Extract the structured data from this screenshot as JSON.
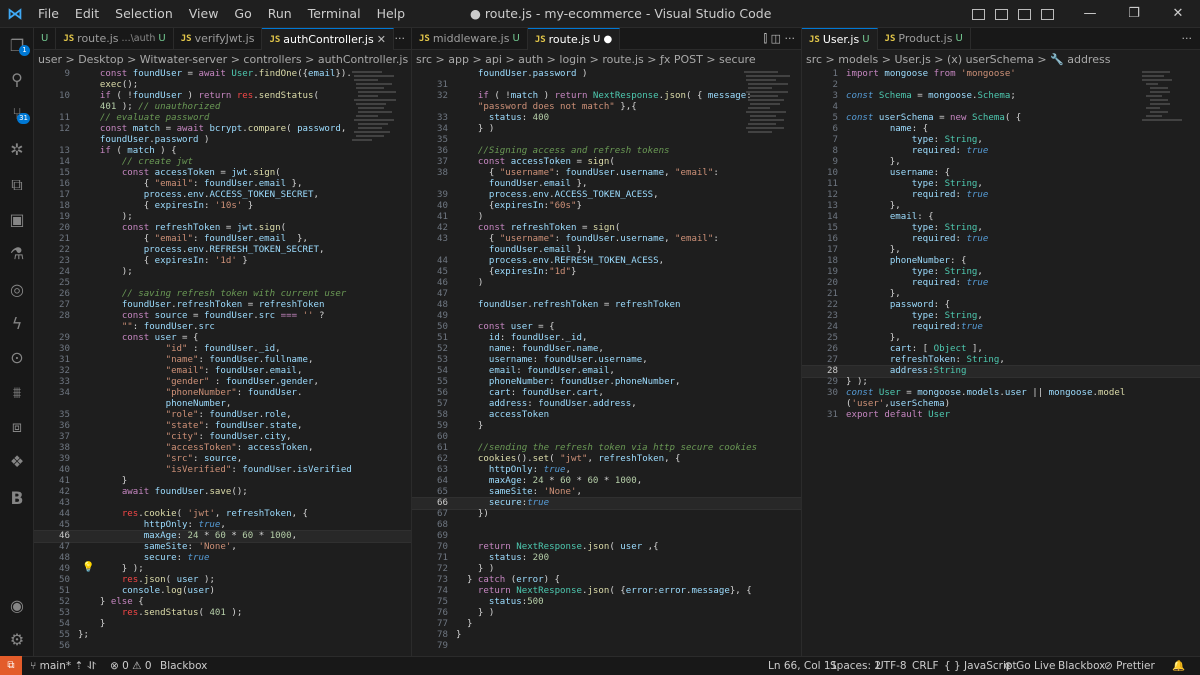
{
  "titlebar": {
    "menus": [
      "File",
      "Edit",
      "Selection",
      "View",
      "Go",
      "Run",
      "Terminal",
      "Help"
    ],
    "title": "● route.js - my-ecommerce - Visual Studio Code",
    "buttons": {
      "minimize": "—",
      "restore": "❐",
      "close": "✕"
    }
  },
  "activity": {
    "source_control_badge": "31",
    "explorer_badge": "1",
    "blackbox_letter": "B"
  },
  "groups": [
    {
      "tabs": [
        {
          "label": "U",
          "extra": "",
          "status": "",
          "active": false
        },
        {
          "label": "route.js",
          "extra": "...\\auth",
          "status": "U",
          "active": false
        },
        {
          "label": "verifyJwt.js",
          "extra": "",
          "status": "",
          "active": false
        },
        {
          "label": "authController.js",
          "extra": "",
          "status": "✕",
          "active": true
        }
      ],
      "more": "···",
      "breadcrumb": "user > Desktop > Witwater-server > controllers > authController.js > (x) handleLogin >"
    },
    {
      "tabs": [
        {
          "label": "middleware.js",
          "extra": "",
          "status": "U",
          "active": false
        },
        {
          "label": "route.js",
          "extra": "",
          "status": "U ●",
          "active": true
        }
      ],
      "more": "⫿  ◫  ···",
      "breadcrumb": "src > app > api > auth > login > route.js > ƒx POST > secure"
    },
    {
      "tabs": [
        {
          "label": "User.js",
          "extra": "",
          "status": "U",
          "active": false
        },
        {
          "label": "Product.js",
          "extra": "",
          "status": "U",
          "active": false
        }
      ],
      "more": "···",
      "breadcrumb": "src > models > User.js > (x) userSchema > 🔧 address"
    }
  ],
  "code1": [
    {
      "n": "9",
      "h": "    <span class=\"k\">const</span> <span class=\"v\">foundUser</span> = <span class=\"k\">await</span> <span class=\"t\">User</span>.<span class=\"f\">findOne</span>({<span class=\"v\">email</span>})."
    },
    {
      "n": "",
      "h": "    <span class=\"f\">exec</span>();"
    },
    {
      "n": "10",
      "h": "    <span class=\"k\">if</span> ( !<span class=\"v\">foundUser</span> ) <span class=\"k\">return</span> <span class=\"r\">res</span>.<span class=\"f\">sendStatus</span>("
    },
    {
      "n": "",
      "h": "    <span class=\"n\">401</span> ); <span class=\"c\">// unauthorized</span>"
    },
    {
      "n": "11",
      "h": "    <span class=\"c\">// evaluate password</span>"
    },
    {
      "n": "12",
      "h": "    <span class=\"k\">const</span> <span class=\"v\">match</span> = <span class=\"k\">await</span> <span class=\"v\">bcrypt</span>.<span class=\"f\">compare</span>( <span class=\"v\">password</span>,"
    },
    {
      "n": "",
      "h": "    <span class=\"v\">foundUser</span>.<span class=\"v\">password</span> )"
    },
    {
      "n": "13",
      "h": "    <span class=\"k\">if</span> ( <span class=\"v\">match</span> ) {"
    },
    {
      "n": "14",
      "h": "        <span class=\"c\">// create jwt</span>"
    },
    {
      "n": "15",
      "h": "        <span class=\"k\">const</span> <span class=\"v\">accessToken</span> = <span class=\"v\">jwt</span>.<span class=\"f\">sign</span>("
    },
    {
      "n": "16",
      "h": "            { <span class=\"s\">\"email\"</span>: <span class=\"v\">foundUser</span>.<span class=\"v\">email</span> },"
    },
    {
      "n": "17",
      "h": "            <span class=\"v\">process</span>.<span class=\"v\">env</span>.<span class=\"v\">ACCESS_TOKEN_SECRET</span>,"
    },
    {
      "n": "18",
      "h": "            { <span class=\"v\">expiresIn</span>: <span class=\"s\">'10s'</span> }"
    },
    {
      "n": "19",
      "h": "        );"
    },
    {
      "n": "20",
      "h": "        <span class=\"k\">const</span> <span class=\"v\">refreshToken</span> = <span class=\"v\">jwt</span>.<span class=\"f\">sign</span>("
    },
    {
      "n": "21",
      "h": "            { <span class=\"s\">\"email\"</span>: <span class=\"v\">foundUser</span>.<span class=\"v\">email</span>  },"
    },
    {
      "n": "22",
      "h": "            <span class=\"v\">process</span>.<span class=\"v\">env</span>.<span class=\"v\">REFRESH_TOKEN_SECRET</span>,"
    },
    {
      "n": "23",
      "h": "            { <span class=\"v\">expiresIn</span>: <span class=\"s\">'1d'</span> }"
    },
    {
      "n": "24",
      "h": "        );"
    },
    {
      "n": "25",
      "h": ""
    },
    {
      "n": "26",
      "h": "        <span class=\"c\">// saving refresh token with current user</span>"
    },
    {
      "n": "27",
      "h": "        <span class=\"v\">foundUser</span>.<span class=\"v\">refreshToken</span> = <span class=\"v\">refreshToken</span>"
    },
    {
      "n": "28",
      "h": "        <span class=\"k\">const</span> <span class=\"v\">source</span> = <span class=\"v\">foundUser</span>.<span class=\"v\">src</span> <span class=\"k\">===</span> <span class=\"s\">''</span> ?"
    },
    {
      "n": "",
      "h": "        <span class=\"s\">\"\"</span>: <span class=\"v\">foundUser</span>.<span class=\"v\">src</span>"
    },
    {
      "n": "29",
      "h": "        <span class=\"k\">const</span> <span class=\"v\">user</span> = {"
    },
    {
      "n": "30",
      "h": "                <span class=\"s\">\"id\"</span> : <span class=\"v\">foundUser</span>.<span class=\"v\">_id</span>,"
    },
    {
      "n": "31",
      "h": "                <span class=\"s\">\"name\"</span>: <span class=\"v\">foundUser</span>.<span class=\"v\">fullname</span>,"
    },
    {
      "n": "32",
      "h": "                <span class=\"s\">\"email\"</span>: <span class=\"v\">foundUser</span>.<span class=\"v\">email</span>,"
    },
    {
      "n": "33",
      "h": "                <span class=\"s\">\"gender\"</span> : <span class=\"v\">foundUser</span>.<span class=\"v\">gender</span>,"
    },
    {
      "n": "34",
      "h": "                <span class=\"s\">\"phoneNumber\"</span>: <span class=\"v\">foundUser</span>."
    },
    {
      "n": "",
      "h": "                <span class=\"v\">phoneNumber</span>,"
    },
    {
      "n": "35",
      "h": "                <span class=\"s\">\"role\"</span>: <span class=\"v\">foundUser</span>.<span class=\"v\">role</span>,"
    },
    {
      "n": "36",
      "h": "                <span class=\"s\">\"state\"</span>: <span class=\"v\">foundUser</span>.<span class=\"v\">state</span>,"
    },
    {
      "n": "37",
      "h": "                <span class=\"s\">\"city\"</span>: <span class=\"v\">foundUser</span>.<span class=\"v\">city</span>,"
    },
    {
      "n": "38",
      "h": "                <span class=\"s\">\"accessToken\"</span>: <span class=\"v\">accessToken</span>,"
    },
    {
      "n": "39",
      "h": "                <span class=\"s\">\"src\"</span>: <span class=\"v\">source</span>,"
    },
    {
      "n": "40",
      "h": "                <span class=\"s\">\"isVerified\"</span>: <span class=\"v\">foundUser</span>.<span class=\"v\">isVerified</span>"
    },
    {
      "n": "41",
      "h": "        }"
    },
    {
      "n": "42",
      "h": "        <span class=\"k\">await</span> <span class=\"v\">foundUser</span>.<span class=\"f\">save</span>();"
    },
    {
      "n": "43",
      "h": ""
    },
    {
      "n": "44",
      "h": "        <span class=\"r\">res</span>.<span class=\"f\">cookie</span>( <span class=\"s\">'jwt'</span>, <span class=\"v\">refreshToken</span>, {"
    },
    {
      "n": "45",
      "h": "            <span class=\"v\">httpOnly</span>: <span class=\"kb\">true</span>,"
    },
    {
      "n": "46",
      "h": "            <span class=\"v\">maxAge</span>: <span class=\"n\">24</span> * <span class=\"n\">60</span> * <span class=\"n\">60</span> * <span class=\"n\">1000</span>,",
      "cur": true
    },
    {
      "n": "47",
      "h": "            <span class=\"v\">sameSite</span>: <span class=\"s\">'None'</span>,"
    },
    {
      "n": "48",
      "h": "            <span class=\"v\">secure</span>: <span class=\"kb\">true</span>"
    },
    {
      "n": "49",
      "h": "        } );"
    },
    {
      "n": "50",
      "h": "        <span class=\"r\">res</span>.<span class=\"f\">json</span>( <span class=\"v\">user</span> );"
    },
    {
      "n": "51",
      "h": "        <span class=\"v\">console</span>.<span class=\"f\">log</span>(<span class=\"v\">user</span>)"
    },
    {
      "n": "52",
      "h": "    } <span class=\"k\">else</span> {"
    },
    {
      "n": "53",
      "h": "        <span class=\"r\">res</span>.<span class=\"f\">sendStatus</span>( <span class=\"n\">401</span> );"
    },
    {
      "n": "54",
      "h": "    }"
    },
    {
      "n": "55",
      "h": "};"
    },
    {
      "n": "56",
      "h": ""
    }
  ],
  "code2": [
    {
      "n": "",
      "h": "    <span class=\"v\">foundUser</span>.<span class=\"v\">password</span> )"
    },
    {
      "n": "31",
      "h": ""
    },
    {
      "n": "32",
      "h": "    <span class=\"k\">if</span> ( !<span class=\"v\">match</span> ) <span class=\"k\">return</span> <span class=\"t\">NextResponse</span>.<span class=\"f\">json</span>( { <span class=\"v\">message</span>:"
    },
    {
      "n": "",
      "h": "    <span class=\"s\">\"password does not match\"</span> },{"
    },
    {
      "n": "33",
      "h": "      <span class=\"v\">status</span>: <span class=\"n\">400</span>"
    },
    {
      "n": "34",
      "h": "    } )"
    },
    {
      "n": "35",
      "h": ""
    },
    {
      "n": "36",
      "h": "    <span class=\"c\">//Signing access and refresh tokens</span>"
    },
    {
      "n": "37",
      "h": "    <span class=\"k\">const</span> <span class=\"v\">accessToken</span> = <span class=\"f\">sign</span>("
    },
    {
      "n": "38",
      "h": "      { <span class=\"s\">\"username\"</span>: <span class=\"v\">foundUser</span>.<span class=\"v\">username</span>, <span class=\"s\">\"email\"</span>:"
    },
    {
      "n": "",
      "h": "      <span class=\"v\">foundUser</span>.<span class=\"v\">email</span> },"
    },
    {
      "n": "39",
      "h": "      <span class=\"v\">process</span>.<span class=\"v\">env</span>.<span class=\"v\">ACCESS_TOKEN_ACESS</span>,"
    },
    {
      "n": "40",
      "h": "      {<span class=\"v\">expiresIn</span>:<span class=\"s\">\"60s\"</span>}"
    },
    {
      "n": "41",
      "h": "    )"
    },
    {
      "n": "42",
      "h": "    <span class=\"k\">const</span> <span class=\"v\">refreshToken</span> = <span class=\"f\">sign</span>("
    },
    {
      "n": "43",
      "h": "      { <span class=\"s\">\"username\"</span>: <span class=\"v\">foundUser</span>.<span class=\"v\">username</span>, <span class=\"s\">\"email\"</span>:"
    },
    {
      "n": "",
      "h": "      <span class=\"v\">foundUser</span>.<span class=\"v\">email</span> },"
    },
    {
      "n": "44",
      "h": "      <span class=\"v\">process</span>.<span class=\"v\">env</span>.<span class=\"v\">REFRESH_TOKEN_ACESS</span>,"
    },
    {
      "n": "45",
      "h": "      {<span class=\"v\">expiresIn</span>:<span class=\"s\">\"1d\"</span>}"
    },
    {
      "n": "46",
      "h": "    )"
    },
    {
      "n": "47",
      "h": ""
    },
    {
      "n": "48",
      "h": "    <span class=\"v\">foundUser</span>.<span class=\"v\">refreshToken</span> = <span class=\"v\">refreshToken</span>"
    },
    {
      "n": "49",
      "h": ""
    },
    {
      "n": "50",
      "h": "    <span class=\"k\">const</span> <span class=\"v\">user</span> = {"
    },
    {
      "n": "51",
      "h": "      <span class=\"v\">id</span>: <span class=\"v\">foundUser</span>.<span class=\"v\">_id</span>,"
    },
    {
      "n": "52",
      "h": "      <span class=\"v\">name</span>: <span class=\"v\">foundUser</span>.<span class=\"v\">name</span>,"
    },
    {
      "n": "53",
      "h": "      <span class=\"v\">username</span>: <span class=\"v\">foundUser</span>.<span class=\"v\">username</span>,"
    },
    {
      "n": "54",
      "h": "      <span class=\"v\">email</span>: <span class=\"v\">foundUser</span>.<span class=\"v\">email</span>,"
    },
    {
      "n": "55",
      "h": "      <span class=\"v\">phoneNumber</span>: <span class=\"v\">foundUser</span>.<span class=\"v\">phoneNumber</span>,"
    },
    {
      "n": "56",
      "h": "      <span class=\"v\">cart</span>: <span class=\"v\">foundUser</span>.<span class=\"v\">cart</span>,"
    },
    {
      "n": "57",
      "h": "      <span class=\"v\">address</span>: <span class=\"v\">foundUser</span>.<span class=\"v\">address</span>,"
    },
    {
      "n": "58",
      "h": "      <span class=\"v\">accessToken</span>"
    },
    {
      "n": "59",
      "h": "    }"
    },
    {
      "n": "60",
      "h": ""
    },
    {
      "n": "61",
      "h": "    <span class=\"c\">//sending the refresh token via http secure cookies</span>"
    },
    {
      "n": "62",
      "h": "    <span class=\"f\">cookies</span>().<span class=\"f\">set</span>( <span class=\"s\">\"jwt\"</span>, <span class=\"v\">refreshToken</span>, {"
    },
    {
      "n": "63",
      "h": "      <span class=\"v\">httpOnly</span>: <span class=\"kb\">true</span>,"
    },
    {
      "n": "64",
      "h": "      <span class=\"v\">maxAge</span>: <span class=\"n\">24</span> * <span class=\"n\">60</span> * <span class=\"n\">60</span> * <span class=\"n\">1000</span>,"
    },
    {
      "n": "65",
      "h": "      <span class=\"v\">sameSite</span>: <span class=\"s\">'None'</span>,"
    },
    {
      "n": "66",
      "h": "      <span class=\"v\">secure</span>:<span class=\"kb\">true</span>",
      "cur": true
    },
    {
      "n": "67",
      "h": "    })"
    },
    {
      "n": "68",
      "h": ""
    },
    {
      "n": "69",
      "h": ""
    },
    {
      "n": "70",
      "h": "    <span class=\"k\">return</span> <span class=\"t\">NextResponse</span>.<span class=\"f\">json</span>( <span class=\"v\">user</span> ,{"
    },
    {
      "n": "71",
      "h": "      <span class=\"v\">status</span>: <span class=\"n\">200</span>"
    },
    {
      "n": "72",
      "h": "    } )"
    },
    {
      "n": "73",
      "h": "  } <span class=\"k\">catch</span> (<span class=\"v\">error</span>) {"
    },
    {
      "n": "74",
      "h": "    <span class=\"k\">return</span> <span class=\"t\">NextResponse</span>.<span class=\"f\">json</span>( {<span class=\"v\">error</span>:<span class=\"v\">error</span>.<span class=\"v\">message</span>}, {"
    },
    {
      "n": "75",
      "h": "      <span class=\"v\">status</span>:<span class=\"n\">500</span>"
    },
    {
      "n": "76",
      "h": "    } )"
    },
    {
      "n": "77",
      "h": "  }"
    },
    {
      "n": "78",
      "h": "}"
    },
    {
      "n": "79",
      "h": ""
    }
  ],
  "code3": [
    {
      "n": "1",
      "h": "<span class=\"k\">import</span> <span class=\"v\">mongoose</span> <span class=\"k\">from</span> <span class=\"s\">'mongoose'</span>"
    },
    {
      "n": "2",
      "h": ""
    },
    {
      "n": "3",
      "h": "<span class=\"kb\">const</span> <span class=\"t\">Schema</span> = <span class=\"v\">mongoose</span>.<span class=\"t\">Schema</span>;"
    },
    {
      "n": "4",
      "h": ""
    },
    {
      "n": "5",
      "h": "<span class=\"kb\">const</span> <span class=\"v\">userSchema</span> = <span class=\"k\">new</span> <span class=\"t\">Schema</span>( {"
    },
    {
      "n": "6",
      "h": "        <span class=\"v\">name</span>: {"
    },
    {
      "n": "7",
      "h": "            <span class=\"v\">type</span>: <span class=\"t\">String</span>,"
    },
    {
      "n": "8",
      "h": "            <span class=\"v\">required</span>: <span class=\"kb\">true</span>"
    },
    {
      "n": "9",
      "h": "        },"
    },
    {
      "n": "10",
      "h": "        <span class=\"v\">username</span>: {"
    },
    {
      "n": "11",
      "h": "            <span class=\"v\">type</span>: <span class=\"t\">String</span>,"
    },
    {
      "n": "12",
      "h": "            <span class=\"v\">required</span>: <span class=\"kb\">true</span>"
    },
    {
      "n": "13",
      "h": "        },"
    },
    {
      "n": "14",
      "h": "        <span class=\"v\">email</span>: {"
    },
    {
      "n": "15",
      "h": "            <span class=\"v\">type</span>: <span class=\"t\">String</span>,"
    },
    {
      "n": "16",
      "h": "            <span class=\"v\">required</span>: <span class=\"kb\">true</span>"
    },
    {
      "n": "17",
      "h": "        },"
    },
    {
      "n": "18",
      "h": "        <span class=\"v\">phoneNumber</span>: {"
    },
    {
      "n": "19",
      "h": "            <span class=\"v\">type</span>: <span class=\"t\">String</span>,"
    },
    {
      "n": "20",
      "h": "            <span class=\"v\">required</span>: <span class=\"kb\">true</span>"
    },
    {
      "n": "21",
      "h": "        },"
    },
    {
      "n": "22",
      "h": "        <span class=\"v\">password</span>: {"
    },
    {
      "n": "23",
      "h": "            <span class=\"v\">type</span>: <span class=\"t\">String</span>,"
    },
    {
      "n": "24",
      "h": "            <span class=\"v\">required</span>:<span class=\"kb\">true</span>"
    },
    {
      "n": "25",
      "h": "        },"
    },
    {
      "n": "26",
      "h": "        <span class=\"v\">cart</span>: [ <span class=\"t\">Object</span> ],"
    },
    {
      "n": "27",
      "h": "        <span class=\"v\">refreshToken</span>: <span class=\"t\">String</span>,"
    },
    {
      "n": "28",
      "h": "        <span class=\"v\">address</span>:<span class=\"t\">String</span>",
      "cur": true
    },
    {
      "n": "29",
      "h": "} );"
    },
    {
      "n": "30",
      "h": "<span class=\"kb\">const</span> <span class=\"t\">User</span> = <span class=\"v\">mongoose</span>.<span class=\"v\">models</span>.<span class=\"v\">user</span> || <span class=\"v\">mongoose</span>.<span class=\"f\">model</span>"
    },
    {
      "n": "",
      "h": "(<span class=\"s\">'user'</span>,<span class=\"v\">userSchema</span>)"
    },
    {
      "n": "31",
      "h": "<span class=\"k\">export</span> <span class=\"k\">default</span> <span class=\"t\">User</span>"
    }
  ],
  "status": {
    "remote": "⧉",
    "branch": "main*",
    "sync": "⥯",
    "problems": "⊗ 0 ⚠ 0",
    "blackbox_left": "Blackbox",
    "position": "Ln 66, Col 11",
    "spaces": "Spaces: 2",
    "encoding": "UTF-8",
    "eol": "CRLF",
    "language": "{ } JavaScript",
    "golive": "⊛ Go Live",
    "blackbox_right": "Blackbox",
    "prettier": "⊘ Prettier",
    "bell": "🔔"
  }
}
